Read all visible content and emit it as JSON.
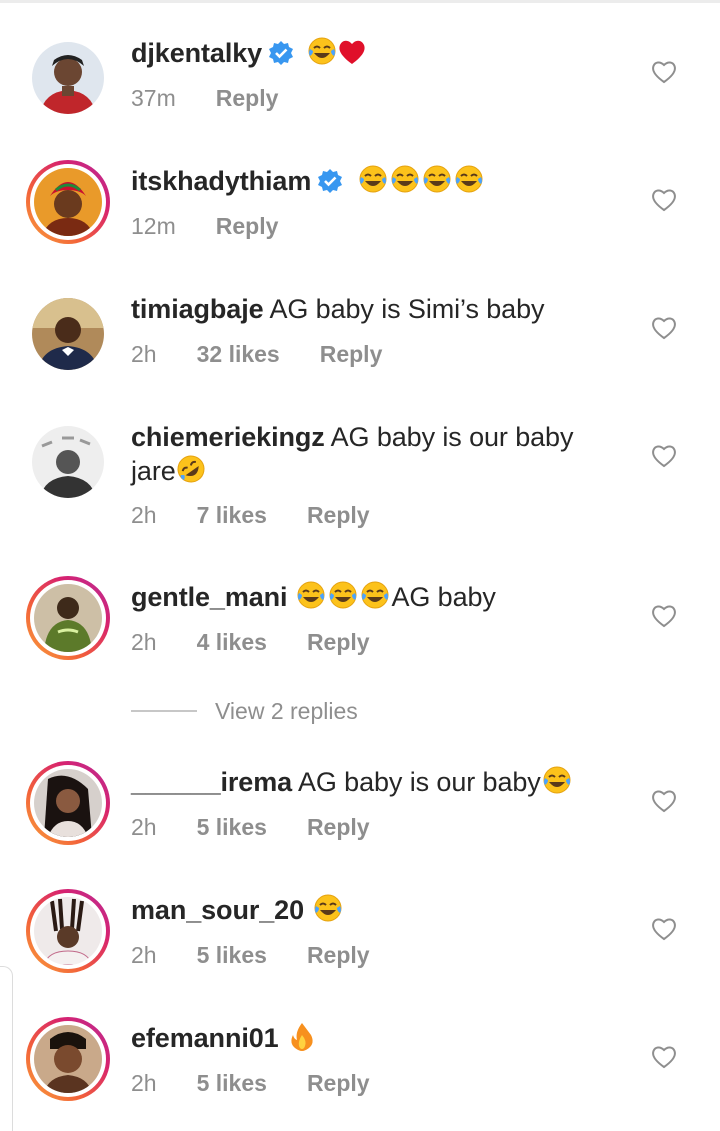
{
  "comments": [
    {
      "username": "djkentalky",
      "verified": true,
      "text": "",
      "emojis": [
        "laugh-cry",
        "heart"
      ],
      "time": "37m",
      "likes": "",
      "reply": "Reply",
      "story_ring": false,
      "avatar": "djkentalky-avatar"
    },
    {
      "username": "itskhadythiam",
      "verified": true,
      "text": "",
      "emojis": [
        "laugh-cry",
        "laugh-cry",
        "laugh-cry",
        "laugh-cry"
      ],
      "time": "12m",
      "likes": "",
      "reply": "Reply",
      "story_ring": true,
      "avatar": "itskhadythiam-avatar"
    },
    {
      "username": "timiagbaje",
      "verified": false,
      "text": "AG baby is Simi’s baby",
      "emojis": [],
      "time": "2h",
      "likes": "32 likes",
      "reply": "Reply",
      "story_ring": false,
      "avatar": "timiagbaje-avatar"
    },
    {
      "username": "chiemeriekingz",
      "verified": false,
      "text": "AG baby is our baby",
      "text2": "jare",
      "emojis": [
        "rofl"
      ],
      "time": "2h",
      "likes": "7 likes",
      "reply": "Reply",
      "story_ring": false,
      "avatar": "chiemeriekingz-avatar"
    },
    {
      "username": "gentle_mani",
      "verified": false,
      "text": "AG baby",
      "emojis": [
        "laugh-cry",
        "laugh-cry",
        "laugh-cry"
      ],
      "time": "2h",
      "likes": "4 likes",
      "reply": "Reply",
      "story_ring": true,
      "avatar": "gentle-mani-avatar"
    },
    {
      "username": "______irema",
      "verified": false,
      "text": "AG baby is our baby",
      "emojis": [
        "laugh-cry"
      ],
      "time": "2h",
      "likes": "5 likes",
      "reply": "Reply",
      "story_ring": true,
      "avatar": "irema-avatar"
    },
    {
      "username": "man_sour_20",
      "verified": false,
      "text": "",
      "emojis": [
        "laugh-cry"
      ],
      "time": "2h",
      "likes": "5 likes",
      "reply": "Reply",
      "story_ring": true,
      "avatar": "man-sour-avatar"
    },
    {
      "username": "efemanni01",
      "verified": false,
      "text": "",
      "emojis": [
        "fire"
      ],
      "time": "2h",
      "likes": "5 likes",
      "reply": "Reply",
      "story_ring": true,
      "avatar": "efemanni-avatar"
    }
  ],
  "view_replies": "View 2 replies",
  "colors": {
    "verified_blue": "#3897f0",
    "meta_gray": "#8e8e8e",
    "heart_red": "#e0245e"
  }
}
